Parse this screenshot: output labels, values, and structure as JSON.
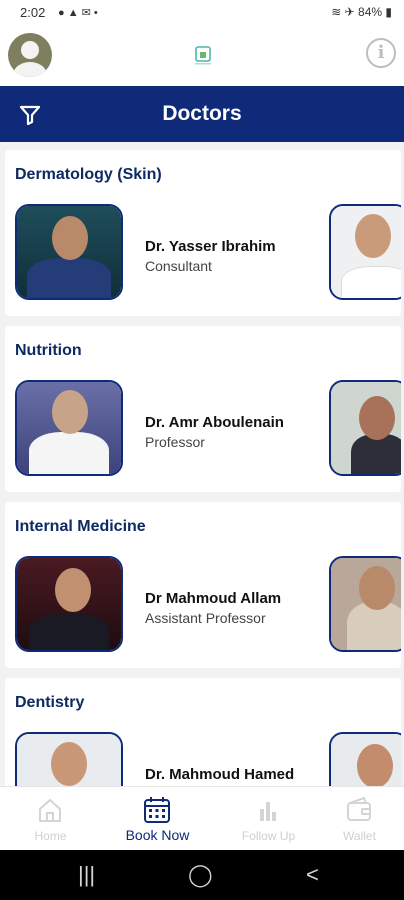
{
  "status_bar": {
    "time": "2:02",
    "battery": "84%"
  },
  "header": {
    "title": "Doctors"
  },
  "sections": [
    {
      "title": "Dermatology (Skin)",
      "doctors": [
        {
          "name": "Dr. Yasser Ibrahim",
          "role": "Consultant"
        }
      ]
    },
    {
      "title": "Nutrition",
      "doctors": [
        {
          "name": "Dr. Amr Aboulenain",
          "role": "Professor"
        }
      ]
    },
    {
      "title": "Internal Medicine",
      "doctors": [
        {
          "name": "Dr Mahmoud Allam",
          "role": "Assistant Professor"
        }
      ]
    },
    {
      "title": "Dentistry",
      "doctors": [
        {
          "name": "Dr. Mahmoud Hamed",
          "role": ""
        }
      ]
    }
  ],
  "bottom_nav": [
    {
      "label": "Home",
      "icon": "home-icon",
      "active": false
    },
    {
      "label": "Book Now",
      "icon": "calendar-icon",
      "active": true
    },
    {
      "label": "Follow Up",
      "icon": "bar-chart-icon",
      "active": false
    },
    {
      "label": "Wallet",
      "icon": "wallet-icon",
      "active": false
    }
  ],
  "colors": {
    "primary": "#0e2a78",
    "section_title": "#0e2a62",
    "background": "#f2f2f2"
  }
}
